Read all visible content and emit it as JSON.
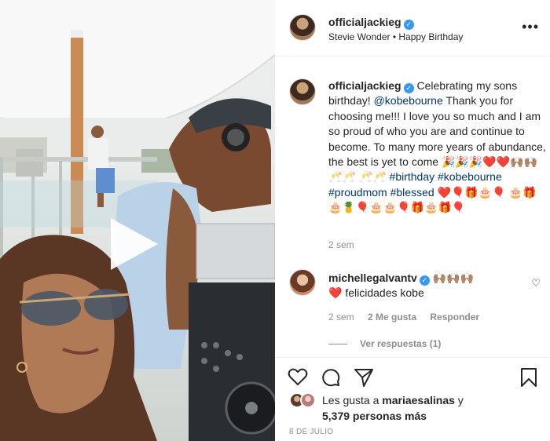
{
  "post": {
    "username": "officialjackieg",
    "audio": "Stevie Wonder • Happy Birthday",
    "more_label": "•••"
  },
  "caption": {
    "username": "officialjackieg",
    "text_part1": "Celebrating my sons birthday!",
    "mention": "@kobebourne",
    "text_part2": "Thank you for choosing me!!! I love you so much and I am so proud of who you are and continue to become. To many more years of abundance, the best is yet to come",
    "emoji_line1": "🎉🎉🎉❤️❤️🙌🏽🙌🏽🥂🥂",
    "emoji_line2": "🥂🥂",
    "hashtag1": "#birthday",
    "hashtag2": "#kobebourne",
    "hashtag3": "#proudmom",
    "hashtag4": "#blessed",
    "emoji_line3": "❤️🎈🎁🎂🎈",
    "emoji_line4": "🎂🎁🎂🍍🎈🎂🎂🎈🎁🎂🎁🎈",
    "time": "2 sem"
  },
  "comment": {
    "username": "michellegalvantv",
    "emojis": "🙌🏽🙌🏽🙌🏽",
    "heart": "❤️",
    "text": "felicidades kobe",
    "time": "2 sem",
    "likes": "2 Me gusta",
    "reply": "Responder",
    "view_replies": "Ver respuestas (1)"
  },
  "likes": {
    "prefix": "Les gusta a",
    "user": "mariaesalinas",
    "connector": "y",
    "count": "5,379 personas más"
  },
  "date": "8 DE JULIO",
  "colors": {
    "link": "#00376b",
    "verified": "#3897f0",
    "muted": "#8e8e8e"
  }
}
